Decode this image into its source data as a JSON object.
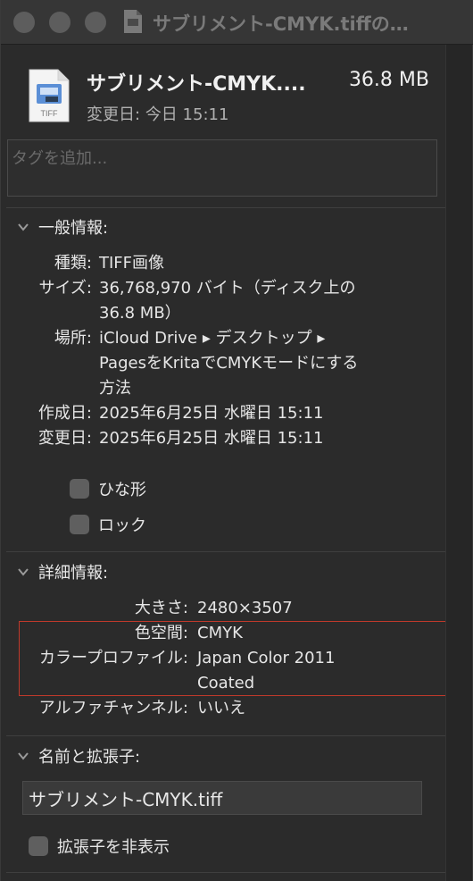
{
  "window": {
    "title": "サブリメント-CMYK.tiffの…"
  },
  "header": {
    "file_name": "サブリメント-CMYK....",
    "file_size": "36.8 MB",
    "modified_label": "変更日:",
    "modified_value": "今日 15:11",
    "icon_caption": "TIFF"
  },
  "tags": {
    "placeholder": "タグを追加..."
  },
  "general": {
    "title": "一般情報:",
    "kind_label": "種類:",
    "kind_value": "TIFF画像",
    "size_label": "サイズ:",
    "size_value_line1": "36,768,970 バイト（ディスク上の",
    "size_value_line2": "36.8 MB）",
    "where_label": "場所:",
    "where_value_line1": "iCloud Drive ▸ デスクトップ ▸",
    "where_value_line2": "PagesをKritaでCMYKモードにする",
    "where_value_line3": "方法",
    "created_label": "作成日:",
    "created_value": "2025年6月25日 水曜日 15:11",
    "modified_label": "変更日:",
    "modified_value": "2025年6月25日 水曜日 15:11",
    "stationery_label": "ひな形",
    "locked_label": "ロック"
  },
  "more_info": {
    "title": "詳細情報:",
    "dimensions_label": "大きさ:",
    "dimensions_value": "2480×3507",
    "color_space_label": "色空間:",
    "color_space_value": "CMYK",
    "color_profile_label": "カラープロファイル:",
    "color_profile_value_line1": "Japan Color 2011",
    "color_profile_value_line2": "Coated",
    "alpha_label": "アルファチャンネル:",
    "alpha_value": "いいえ"
  },
  "name_ext": {
    "title": "名前と拡張子:",
    "file_name_value": "サブリメント-CMYK.tiff",
    "hide_ext_label": "拡張子を非表示"
  },
  "colors": {
    "highlight": "#c0392b"
  }
}
